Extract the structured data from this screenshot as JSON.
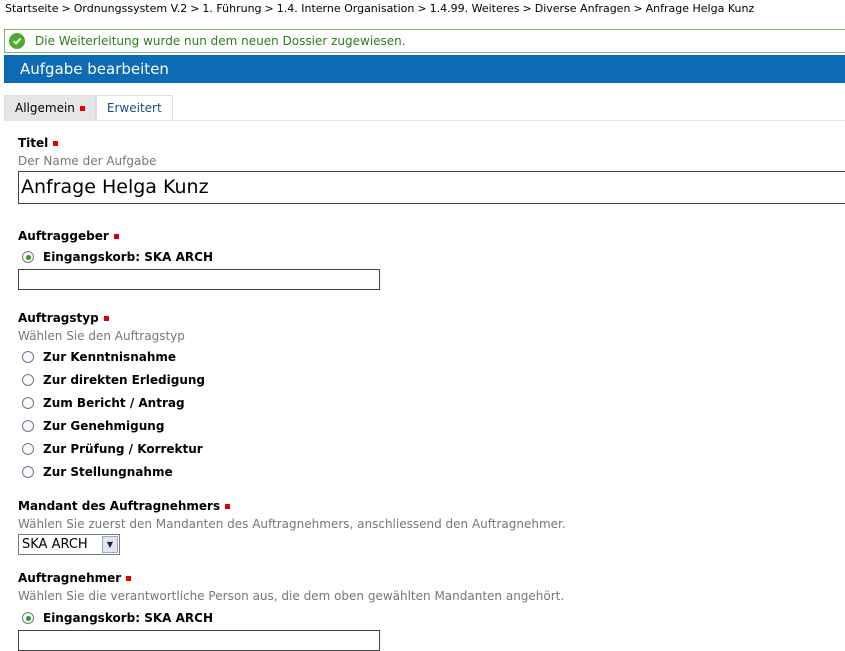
{
  "breadcrumb": {
    "items": [
      "Startseite",
      "Ordnungssystem V.2",
      "1. Führung",
      "1.4. Interne Organisation",
      "1.4.99. Weiteres",
      "Diverse Anfragen",
      "Anfrage Helga Kunz"
    ],
    "separator": ">"
  },
  "message": {
    "text": "Die Weiterleitung wurde nun dem neuen Dossier zugewiesen.",
    "icon": "check-circle-icon"
  },
  "header": {
    "title": "Aufgabe bearbeiten"
  },
  "tabs": [
    {
      "label": "Allgemein",
      "active": true
    },
    {
      "label": "Erweitert",
      "active": false
    }
  ],
  "form": {
    "title": {
      "label": "Titel",
      "help": "Der Name der Aufgabe",
      "value": "Anfrage Helga Kunz"
    },
    "auftraggeber": {
      "label": "Auftraggeber",
      "option": "Eingangskorb: SKA ARCH",
      "input_value": ""
    },
    "auftragstyp": {
      "label": "Auftragstyp",
      "help": "Wählen Sie den Auftragstyp",
      "options": [
        "Zur Kenntnisnahme",
        "Zur direkten Erledigung",
        "Zum Bericht / Antrag",
        "Zur Genehmigung",
        "Zur Prüfung / Korrektur",
        "Zur Stellungnahme"
      ]
    },
    "mandant": {
      "label": "Mandant des Auftragnehmers",
      "help": "Wählen Sie zuerst den Mandanten des Auftragnehmers, anschliessend den Auftragnehmer.",
      "selected": "SKA ARCH"
    },
    "auftragnehmer": {
      "label": "Auftragnehmer",
      "help": "Wählen Sie die verantwortliche Person aus, die dem oben gewählten Mandanten angehört.",
      "option": "Eingangskorb: SKA ARCH",
      "input_value": ""
    }
  },
  "colors": {
    "header": "#0d6ab4",
    "success": "#4caa2e",
    "required": "#e00000"
  }
}
